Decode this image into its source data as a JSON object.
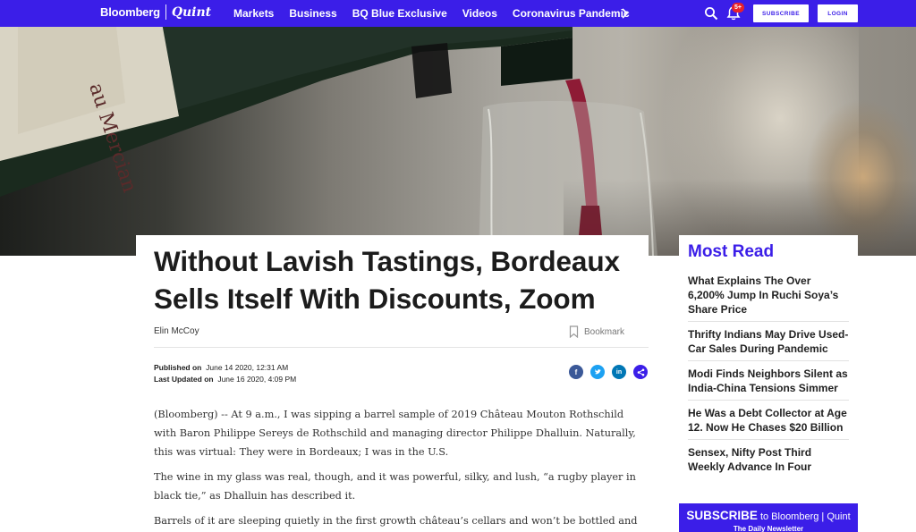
{
  "brand": {
    "left": "Bloomberg",
    "right": "Quint"
  },
  "nav": {
    "links": [
      "Markets",
      "Business",
      "BQ Blue Exclusive",
      "Videos",
      "Coronavirus Pandemic"
    ],
    "notification_count": "5+",
    "subscribe_label": "SUBSCRIBE",
    "login_label": "LOGIN"
  },
  "article": {
    "headline": "Without Lavish Tastings, Bordeaux Sells Itself With Discounts, Zoom",
    "author": "Elin McCoy",
    "bookmark_label": "Bookmark",
    "published_label": "Published on",
    "published_value": "June 14 2020, 12:31 AM",
    "updated_label": "Last Updated on",
    "updated_value": "June 16 2020, 4:09 PM",
    "paragraphs": [
      "(Bloomberg) -- At 9 a.m., I was sipping a barrel sample of 2019 Château Mouton Rothschild with Baron Philippe Sereys de Rothschild and managing director Philippe Dhalluin. Naturally, this was virtual: They were in Bordeaux; I was in the U.S.",
      "The wine in my glass was real, though, and it was powerful, silky, and lush, “a rugby player in black tie,” as Dhalluin has described it.",
      "Barrels of it are sleeping quietly in the first growth château’s cellars and won’t be bottled and"
    ]
  },
  "most_read": {
    "title": "Most Read",
    "items": [
      "What Explains The Over 6,200% Jump In Ruchi Soya’s Share Price",
      "Thrifty Indians May Drive Used-Car Sales During Pandemic",
      "Modi Finds Neighbors Silent as India-China Tensions Simmer",
      "He Was a Debt Collector at Age 12. Now He Chases $20 Billion",
      "Sensex, Nifty Post Third Weekly Advance In Four"
    ]
  },
  "newsletter": {
    "subscribe_word": "SUBSCRIBE",
    "to_text": "to Bloomberg | Quint",
    "subline": "The Daily Newsletter"
  },
  "hero_label_text": "au Mercian"
}
